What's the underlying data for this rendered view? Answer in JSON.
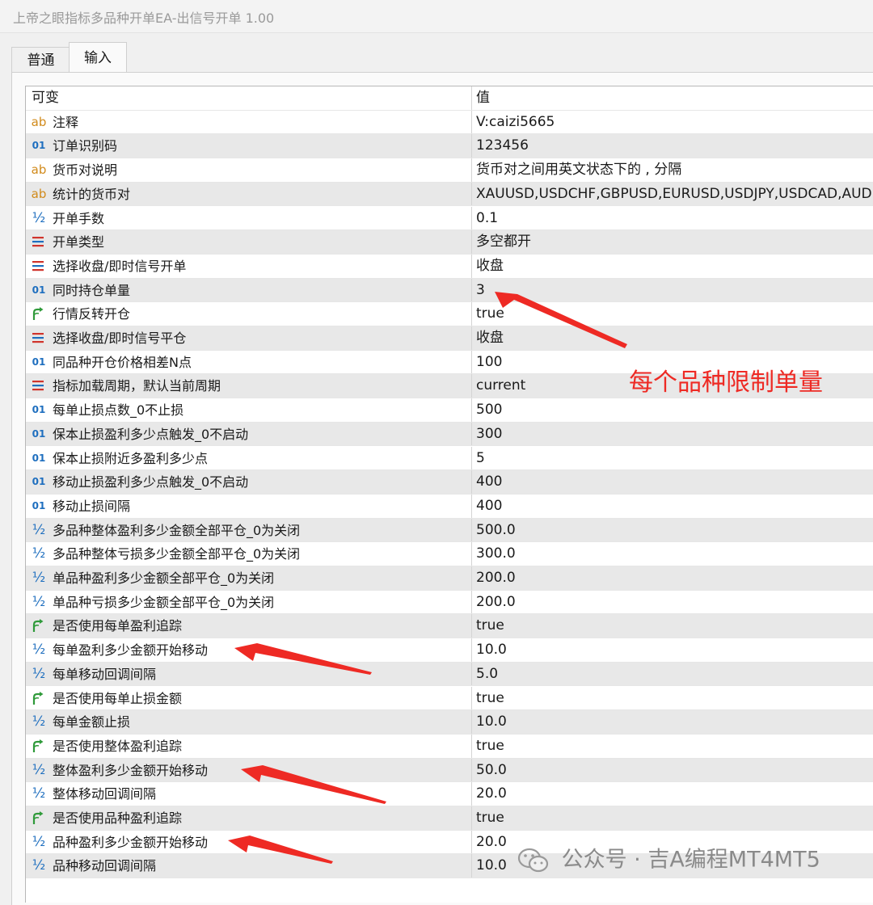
{
  "window": {
    "title": "上帝之眼指标多品种开单EA-出信号开单 1.00"
  },
  "tabs": [
    {
      "label": "普通"
    },
    {
      "label": "输入"
    }
  ],
  "table": {
    "headers": {
      "name": "可变",
      "value": "值"
    },
    "rows": [
      {
        "icon": "ab",
        "name": "注释",
        "value": "V:caizi5665"
      },
      {
        "icon": "int",
        "name": "订单识别码",
        "value": "123456"
      },
      {
        "icon": "ab",
        "name": "货币对说明",
        "value": "货币对之间用英文状态下的 , 分隔"
      },
      {
        "icon": "ab",
        "name": "统计的货币对",
        "value": "XAUUSD,USDCHF,GBPUSD,EURUSD,USDJPY,USDCAD,AUD"
      },
      {
        "icon": "double",
        "name": "开单手数",
        "value": "0.1"
      },
      {
        "icon": "enum",
        "name": "开单类型",
        "value": "多空都开"
      },
      {
        "icon": "enum",
        "name": "选择收盘/即时信号开单",
        "value": "收盘"
      },
      {
        "icon": "int",
        "name": "同时持仓单量",
        "value": "3"
      },
      {
        "icon": "bool",
        "name": "行情反转开仓",
        "value": "true"
      },
      {
        "icon": "enum",
        "name": "选择收盘/即时信号平仓",
        "value": "收盘"
      },
      {
        "icon": "int",
        "name": "同品种开仓价格相差N点",
        "value": "100"
      },
      {
        "icon": "enum",
        "name": "指标加载周期，默认当前周期",
        "value": "current"
      },
      {
        "icon": "int",
        "name": "每单止损点数_0不止损",
        "value": "500"
      },
      {
        "icon": "int",
        "name": "保本止损盈利多少点触发_0不启动",
        "value": "300"
      },
      {
        "icon": "int",
        "name": "保本止损附近多盈利多少点",
        "value": "5"
      },
      {
        "icon": "int",
        "name": "移动止损盈利多少点触发_0不启动",
        "value": "400"
      },
      {
        "icon": "int",
        "name": "移动止损间隔",
        "value": "400"
      },
      {
        "icon": "double",
        "name": "多品种整体盈利多少金额全部平仓_0为关闭",
        "value": "500.0"
      },
      {
        "icon": "double",
        "name": "多品种整体亏损多少金额全部平仓_0为关闭",
        "value": "300.0"
      },
      {
        "icon": "double",
        "name": "单品种盈利多少金额全部平仓_0为关闭",
        "value": "200.0"
      },
      {
        "icon": "double",
        "name": "单品种亏损多少金额全部平仓_0为关闭",
        "value": "200.0"
      },
      {
        "icon": "bool",
        "name": "是否使用每单盈利追踪",
        "value": "true"
      },
      {
        "icon": "double",
        "name": "每单盈利多少金额开始移动",
        "value": "10.0"
      },
      {
        "icon": "double",
        "name": "每单移动回调间隔",
        "value": "5.0"
      },
      {
        "icon": "bool",
        "name": "是否使用每单止损金额",
        "value": "true"
      },
      {
        "icon": "double",
        "name": "每单金额止损",
        "value": "10.0"
      },
      {
        "icon": "bool",
        "name": "是否使用整体盈利追踪",
        "value": "true"
      },
      {
        "icon": "double",
        "name": "整体盈利多少金额开始移动",
        "value": "50.0"
      },
      {
        "icon": "double",
        "name": "整体移动回调间隔",
        "value": "20.0"
      },
      {
        "icon": "bool",
        "name": "是否使用品种盈利追踪",
        "value": "true"
      },
      {
        "icon": "double",
        "name": "品种盈利多少金额开始移动",
        "value": "20.0"
      },
      {
        "icon": "double",
        "name": "品种移动回调间隔",
        "value": "10.0"
      }
    ]
  },
  "annotation": {
    "text": "每个品种限制单量",
    "color": "#ee2a24"
  },
  "watermark": {
    "text": "公众号 · 吉A编程MT4MT5"
  },
  "icon_glyphs": {
    "ab": "ab",
    "int": "01",
    "double": "½"
  }
}
